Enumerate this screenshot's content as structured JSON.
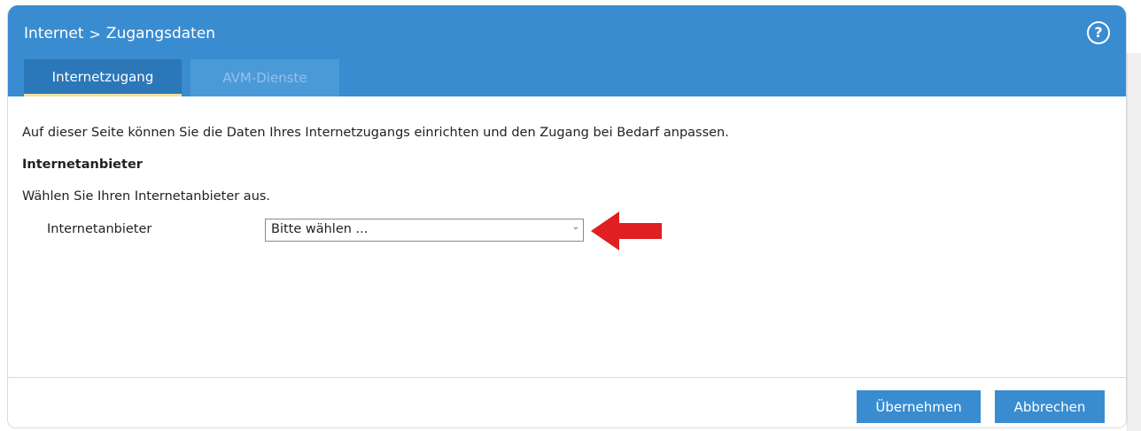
{
  "header": {
    "breadcrumb": [
      "Internet",
      "Zugangsdaten"
    ],
    "breadcrumb_separator": ">",
    "help_icon": "?",
    "background_color": "#3a8cd0"
  },
  "tabs": [
    {
      "label": "Internetzugang",
      "active": true
    },
    {
      "label": "AVM-Dienste",
      "active": false
    }
  ],
  "main": {
    "intro": "Auf dieser Seite können Sie die Daten Ihres Internetzugangs einrichten und den Zugang bei Bedarf anpassen.",
    "section_title": "Internetanbieter",
    "choose_text": "Wählen Sie Ihren Internetanbieter aus.",
    "provider_field": {
      "label": "Internetanbieter",
      "selected": "Bitte wählen ..."
    },
    "annotation_arrow_color": "#e02020"
  },
  "footer": {
    "apply_label": "Übernehmen",
    "cancel_label": "Abbrechen"
  }
}
